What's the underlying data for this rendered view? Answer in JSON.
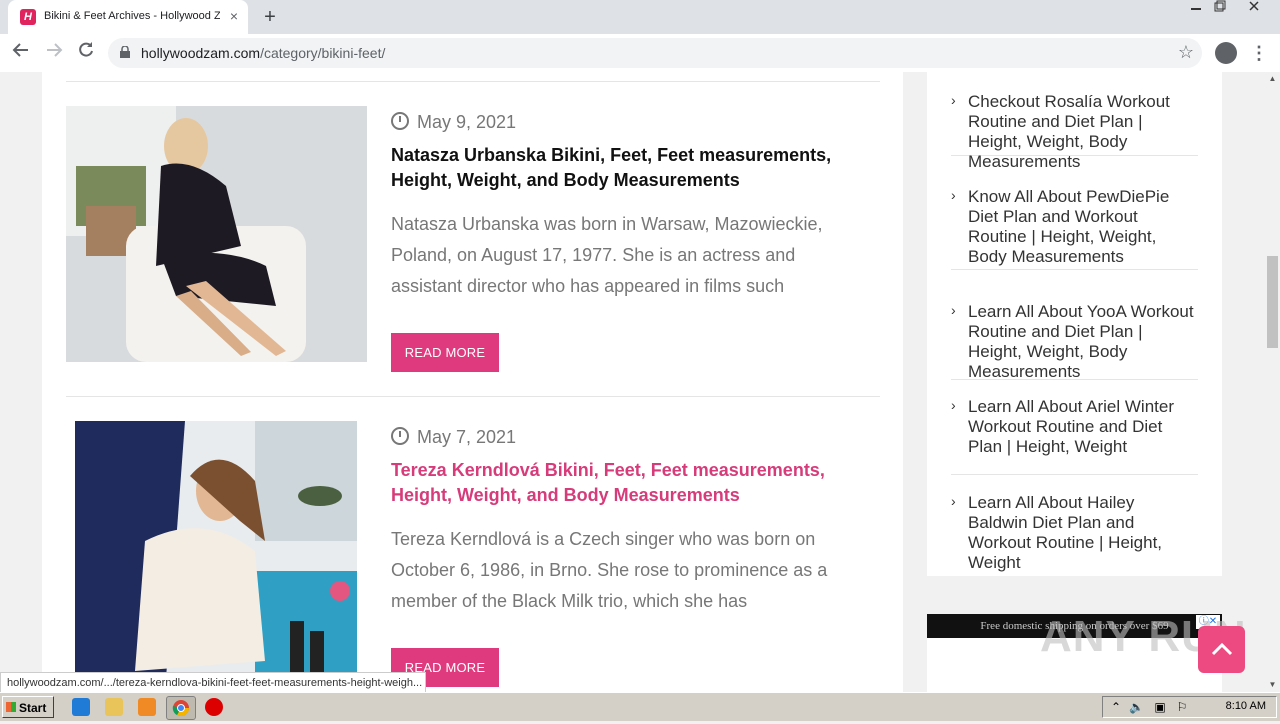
{
  "browser": {
    "tab_title": "Bikini & Feet Archives - Hollywood Z",
    "tab_close": "×",
    "new_tab": "+",
    "url_host": "hollywoodzam.com",
    "url_path": "/category/bikini-feet/",
    "favicon_letter": "H",
    "status_url": "hollywoodzam.com/.../tereza-kerndlova-bikini-feet-feet-measurements-height-weigh..."
  },
  "posts": [
    {
      "date": "May 9, 2021",
      "title": "Natasza Urbanska Bikini, Feet, Feet measurements, Height, Weight, and Body Measurements",
      "excerpt": "Natasza Urbanska was born in Warsaw, Mazowieckie, Poland, on August 17, 1977. She is an actress and assistant director who has appeared in films such",
      "button": "READ MORE"
    },
    {
      "date": "May 7, 2021",
      "title": "Tereza Kerndlová Bikini, Feet, Feet measurements, Height, Weight, and Body Measurements",
      "excerpt": "Tereza Kerndlová is a Czech singer who was born on October 6, 1986, in Brno. She rose to prominence as a member of the Black Milk trio, which she has",
      "button": "READ MORE"
    }
  ],
  "sidebar": {
    "items": [
      {
        "label": "Checkout Rosalía Workout Routine and Diet Plan | Height, Weight, Body Measurements"
      },
      {
        "label": "Know All About PewDiePie Diet Plan and Workout Routine | Height, Weight, Body Measurements"
      },
      {
        "label": "Learn All About YooA Workout Routine and Diet Plan | Height, Weight, Body Measurements"
      },
      {
        "label": "Learn All About Ariel Winter Workout Routine and Diet Plan | Height, Weight"
      },
      {
        "label": "Learn All About Hailey Baldwin Diet Plan and Workout Routine | Height, Weight"
      }
    ]
  },
  "ad": {
    "text": "Free domestic shipping on orders over $69"
  },
  "watermark": "ANY RUN",
  "taskbar": {
    "start": "Start",
    "time": "8:10 AM"
  },
  "colors": {
    "accent": "#e03a7e",
    "title_highlight": "#d63c7a",
    "tab_bg": "#dee1e6"
  }
}
